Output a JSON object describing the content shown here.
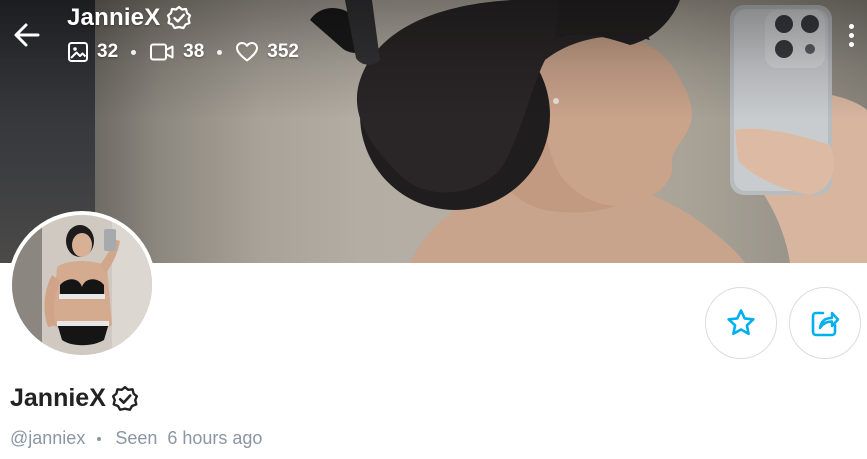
{
  "header": {
    "title": "JannieX",
    "stats": [
      {
        "icon": "image-icon",
        "value": "32"
      },
      {
        "icon": "video-icon",
        "value": "38"
      },
      {
        "icon": "heart-icon",
        "value": "352"
      }
    ]
  },
  "profile": {
    "name": "JannieX",
    "handle": "@janniex",
    "seen_label": "Seen",
    "seen_time": "6 hours ago",
    "verified": true
  },
  "actions": {
    "favorite_icon": "star-icon",
    "share_icon": "share-icon"
  },
  "colors": {
    "accent": "#00aff0",
    "text_primary": "#222222",
    "text_muted": "#8a96a3",
    "button_border": "#dcdcdc"
  }
}
